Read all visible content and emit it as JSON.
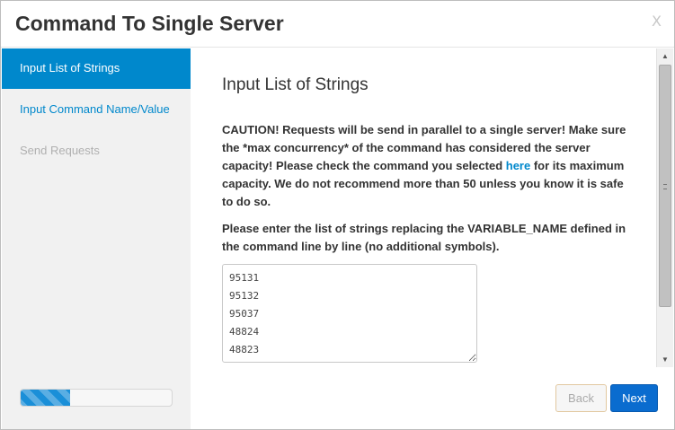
{
  "header": {
    "title": "Command To Single Server",
    "close_label": "X"
  },
  "sidebar": {
    "steps": [
      {
        "label": "Input List of Strings",
        "state": "active"
      },
      {
        "label": "Input Command Name/Value",
        "state": "link"
      },
      {
        "label": "Send Requests",
        "state": "disabled"
      }
    ],
    "progress_percent": 33
  },
  "main": {
    "section_title": "Input List of Strings",
    "caution_before_link": "CAUTION! Requests will be send in parallel to a single server! Make sure the *max concurrency* of the command has considered the server capacity! Please check the command you selected ",
    "caution_link": "here",
    "caution_after_link": " for its maximum capacity. We do not recommend more than 50 unless you know it is safe to do so.",
    "instruction": "Please enter the list of strings replacing the VARIABLE_NAME defined in the command line by line (no additional symbols).",
    "textarea_value": "95131\n95132\n95037\n48824\n48823"
  },
  "footer": {
    "back_label": "Back",
    "next_label": "Next"
  },
  "colors": {
    "accent": "#0088cc",
    "next_button": "#0a6ccf",
    "sidebar_bg": "#f1f1f1"
  }
}
